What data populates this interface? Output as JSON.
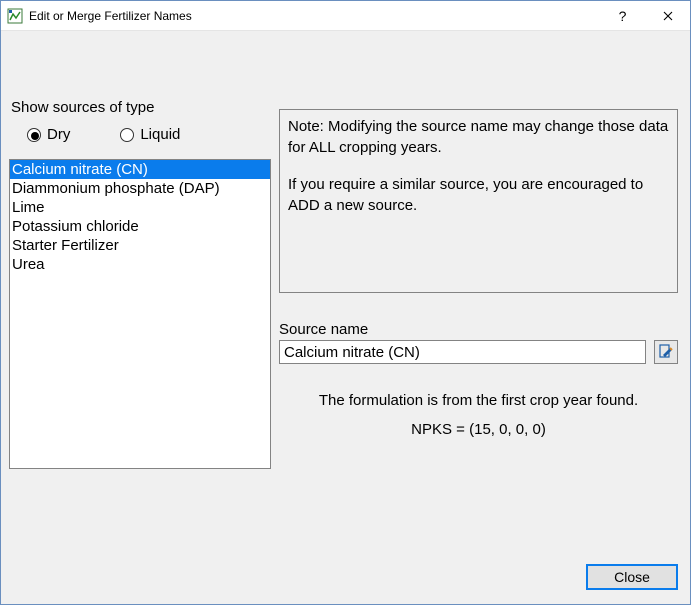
{
  "window": {
    "title": "Edit or Merge Fertilizer Names"
  },
  "filter": {
    "label": "Show sources of type",
    "options": {
      "dry": "Dry",
      "liquid": "Liquid"
    },
    "selected": "dry"
  },
  "list": {
    "items": [
      "Calcium nitrate (CN)",
      "Diammonium phosphate (DAP)",
      "Lime",
      "Potassium chloride",
      "Starter Fertilizer",
      "Urea"
    ],
    "selected_index": 0
  },
  "note": {
    "line1": "Note: Modifying the source name may change those data for ALL cropping years.",
    "line2": "If you require a similar source, you are encouraged to ADD a new source."
  },
  "source_name": {
    "label": "Source name",
    "value": "Calcium nitrate (CN)"
  },
  "formulation": {
    "text": "The formulation is from the first crop year found.",
    "npks_label": "NPKS = (15, 0, 0, 0)",
    "n": 15,
    "p": 0,
    "k": 0,
    "s": 0
  },
  "buttons": {
    "close": "Close"
  }
}
